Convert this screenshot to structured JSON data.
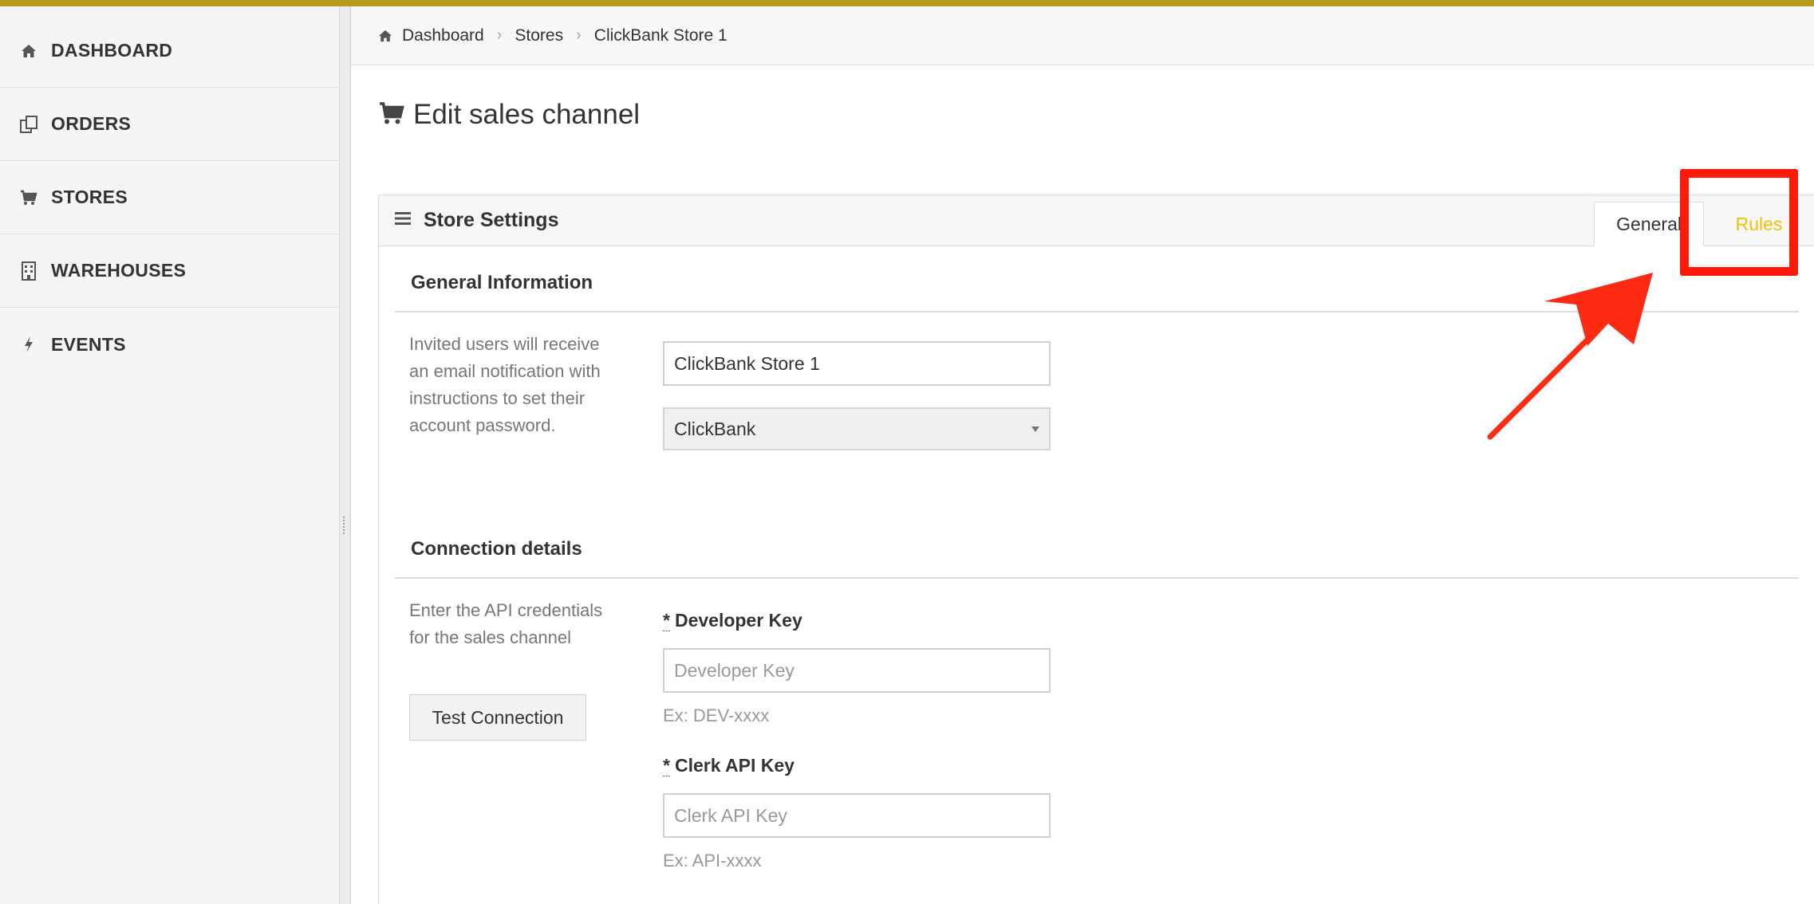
{
  "sidebar": {
    "items": [
      {
        "label": "DASHBOARD",
        "icon": "home-icon"
      },
      {
        "label": "ORDERS",
        "icon": "orders-icon"
      },
      {
        "label": "STORES",
        "icon": "cart-icon"
      },
      {
        "label": "WAREHOUSES",
        "icon": "building-icon"
      },
      {
        "label": "EVENTS",
        "icon": "bolt-icon"
      }
    ]
  },
  "breadcrumb": {
    "items": [
      "Dashboard",
      "Stores",
      "ClickBank Store 1"
    ]
  },
  "page": {
    "title": "Edit sales channel",
    "title_icon": "cart-icon"
  },
  "panel": {
    "title": "Store Settings",
    "tabs": [
      {
        "label": "General",
        "active": true
      },
      {
        "label": "Rules",
        "active": false,
        "color": "#f2c200"
      }
    ]
  },
  "general_info": {
    "title": "General Information",
    "help": "Invited users will receive an email notification with instructions to set their account password.",
    "store_name_value": "ClickBank Store 1",
    "channel_select_value": "ClickBank"
  },
  "connection": {
    "title": "Connection details",
    "help": "Enter the API credentials for the sales channel",
    "test_button": "Test Connection",
    "developer_key": {
      "required_mark": "*",
      "label": "Developer Key",
      "placeholder": "Developer Key",
      "hint": "Ex: DEV-xxxx"
    },
    "clerk_key": {
      "required_mark": "*",
      "label": "Clerk API Key",
      "placeholder": "Clerk API Key",
      "hint": "Ex: API-xxxx"
    }
  },
  "colors": {
    "accent_yellow": "#f2c200",
    "annotation_red": "#ff1a0a",
    "top_strip": "#b89b1e"
  }
}
